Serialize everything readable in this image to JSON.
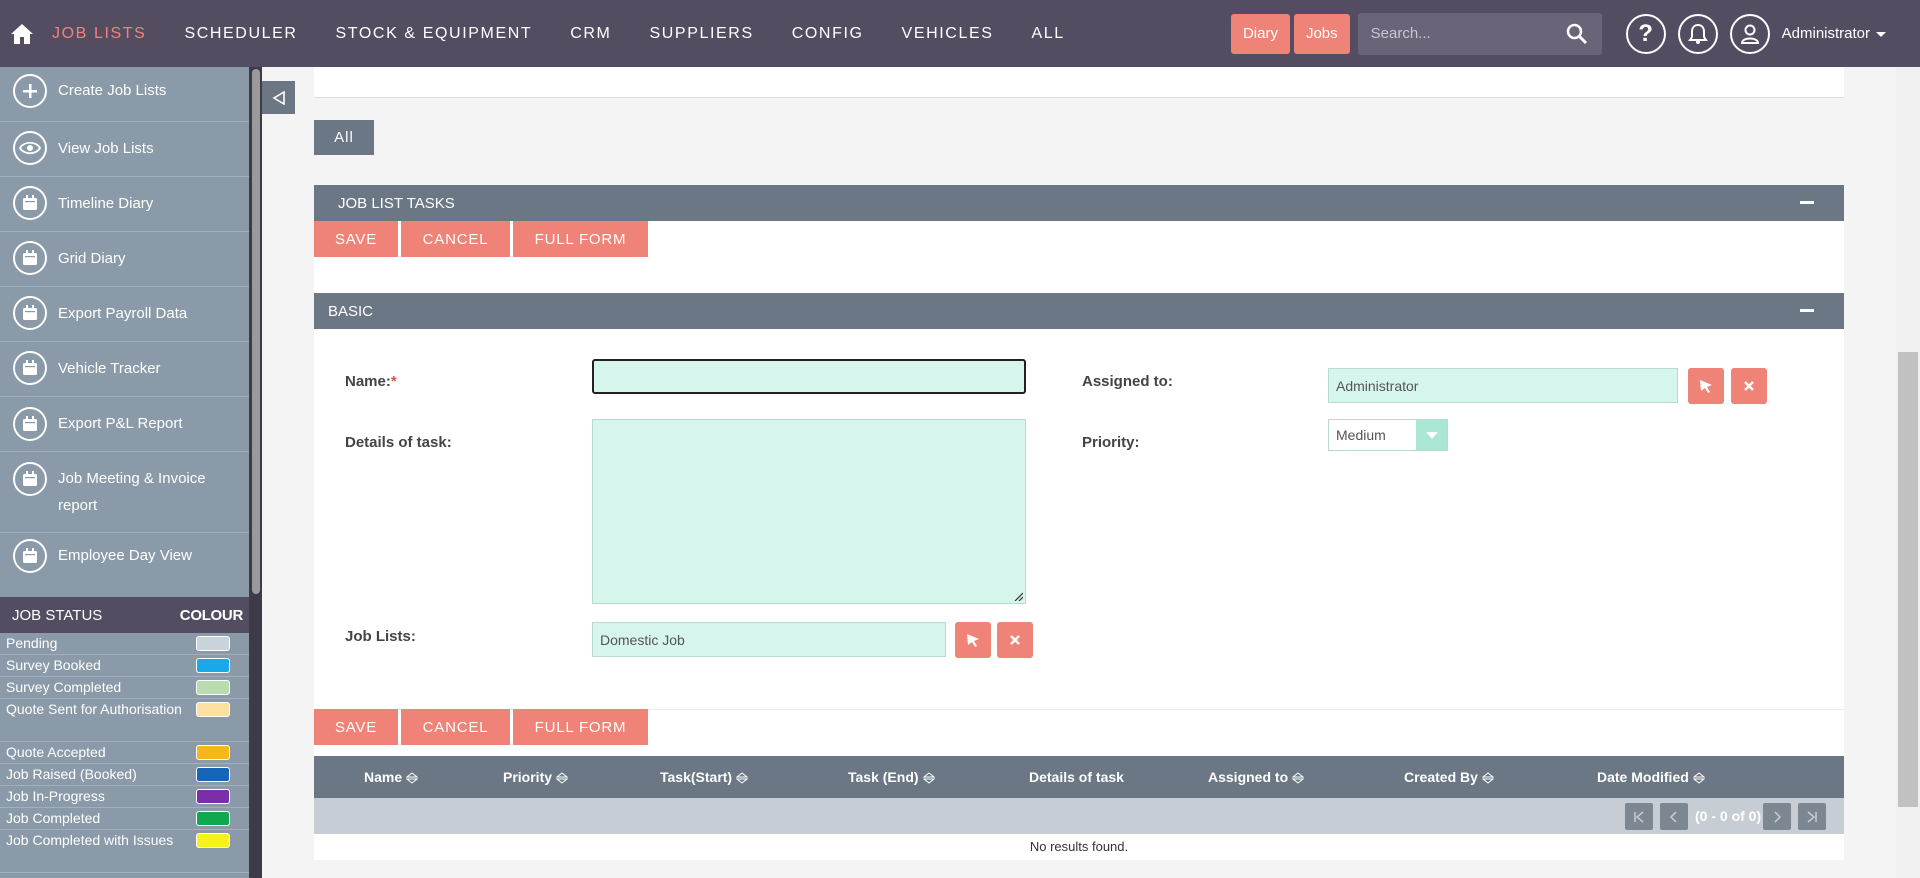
{
  "nav": {
    "items": [
      {
        "label": "JOB LISTS",
        "active": true
      },
      {
        "label": "SCHEDULER"
      },
      {
        "label": "STOCK & EQUIPMENT"
      },
      {
        "label": "CRM"
      },
      {
        "label": "SUPPLIERS"
      },
      {
        "label": "CONFIG"
      },
      {
        "label": "VEHICLES"
      },
      {
        "label": "ALL"
      }
    ],
    "diary_label": "Diary",
    "jobs_label": "Jobs",
    "search_placeholder": "Search...",
    "help_icon": "question-icon",
    "notification_icon": "bell-icon",
    "user_label": "Administrator",
    "accent_color": "#f08377"
  },
  "sidebar": {
    "items": [
      {
        "label": "Create Job Lists",
        "icon": "plus-icon"
      },
      {
        "label": "View Job Lists",
        "icon": "eye-icon"
      },
      {
        "label": "Timeline Diary",
        "icon": "calendar-icon"
      },
      {
        "label": "Grid Diary",
        "icon": "calendar-icon"
      },
      {
        "label": "Export Payroll Data",
        "icon": "calendar-icon"
      },
      {
        "label": "Vehicle Tracker",
        "icon": "calendar-icon"
      },
      {
        "label": "Export P&L Report",
        "icon": "calendar-icon"
      },
      {
        "label": "Job Meeting & Invoice report",
        "icon": "calendar-icon"
      },
      {
        "label": "Employee Day View",
        "icon": "calendar-icon"
      }
    ],
    "status_header": "JOB STATUS",
    "colour_header": "COLOUR",
    "statuses": [
      {
        "label": "Pending",
        "color": "#c9d3dc"
      },
      {
        "label": "Survey Booked",
        "color": "#1aa9e8"
      },
      {
        "label": "Survey Completed",
        "color": "#b9dcae"
      },
      {
        "label": "Quote Sent for Authorisation",
        "color": "#fbe19d"
      },
      {
        "label": "Quote Accepted",
        "color": "#f8b61a"
      },
      {
        "label": "Job Raised (Booked)",
        "color": "#1566b8"
      },
      {
        "label": "Job In-Progress",
        "color": "#7b2ea8"
      },
      {
        "label": "Job Completed",
        "color": "#0fa84d"
      },
      {
        "label": "Job Completed with Issues",
        "color": "#f6f21a"
      }
    ]
  },
  "main": {
    "tab_all": "All",
    "tasks_panel_title": "JOB LIST TASKS",
    "basic_panel_title": "BASIC",
    "save_label": "SAVE",
    "cancel_label": "CANCEL",
    "full_form_label": "FULL FORM",
    "form": {
      "name_label": "Name:",
      "required_mark": "*",
      "name_value": "",
      "details_label": "Details of task:",
      "job_lists_label": "Job Lists:",
      "job_lists_value": "Domestic Job",
      "assigned_label": "Assigned to:",
      "assigned_value": "Administrator",
      "priority_label": "Priority:",
      "priority_value": "Medium"
    },
    "table": {
      "columns": [
        "Name",
        "Priority",
        "Task(Start)",
        "Task (End)",
        "Details of task",
        "Assigned to",
        "Created By",
        "Date Modified"
      ],
      "pagination_text": "(0 - 0 of 0)",
      "empty_text": "No results found."
    }
  }
}
